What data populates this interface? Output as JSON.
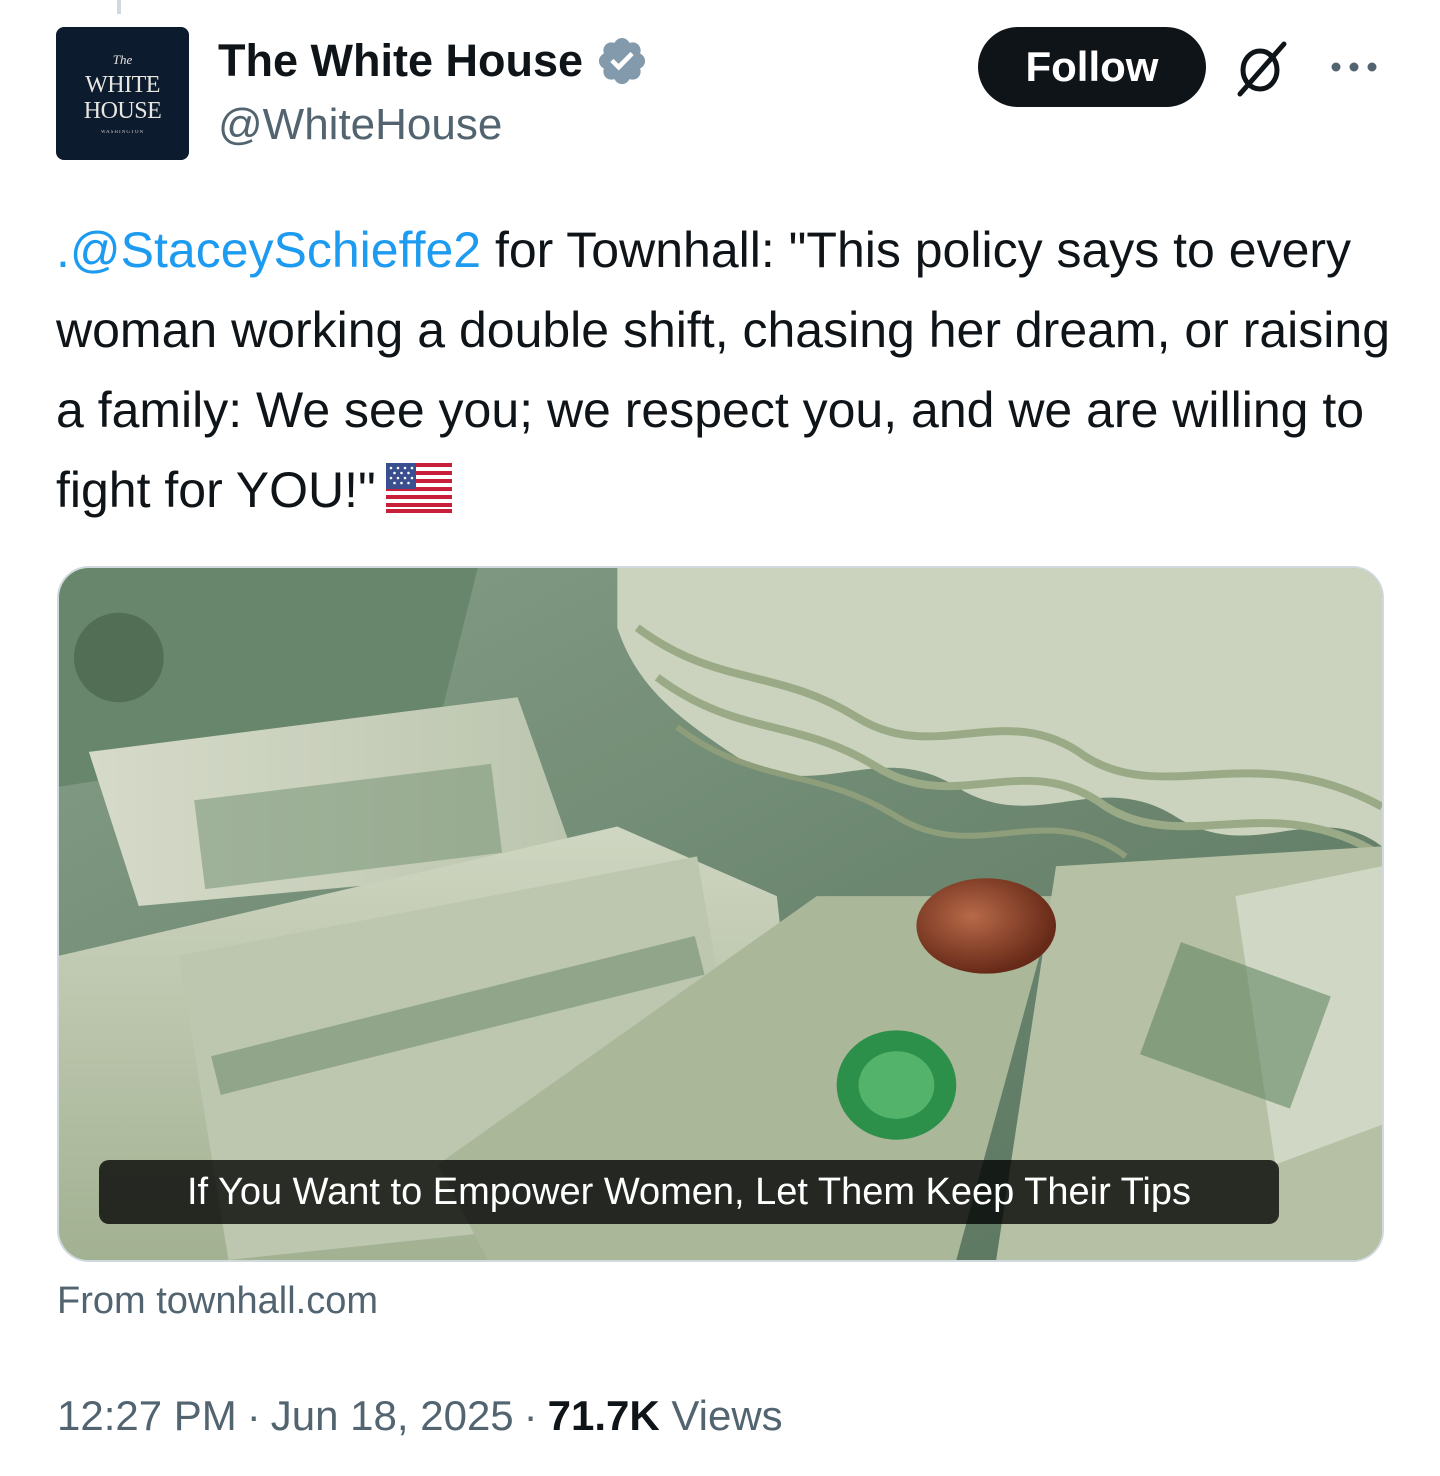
{
  "author": {
    "display_name": "The White House",
    "handle": "@WhiteHouse",
    "avatar": {
      "line1": "The",
      "line2": "WHITE",
      "line3": "HOUSE",
      "line4": "WASHINGTON"
    },
    "verified_icon": "verified-badge-icon",
    "verified_color": "#829aab"
  },
  "actions": {
    "follow_label": "Follow",
    "grok_icon": "grok-icon",
    "more_icon": "more-dots-icon"
  },
  "tweet": {
    "mention": ".@StaceySchieffe2",
    "body": " for Townhall: \"This policy says to every woman working a double shift, chasing her dream, or raising a family: We see you; we respect you, and we are willing to fight for YOU!\"",
    "emoji": "us-flag-emoji"
  },
  "card": {
    "headline": "If You Want to Empower Women, Let Them Keep Their Tips",
    "image_description_icon": "money-tips-photo",
    "source": "From townhall.com"
  },
  "meta": {
    "time": "12:27 PM",
    "date": "Jun 18, 2025",
    "separator": "·",
    "views_count": "71.7K",
    "views_label": "Views"
  },
  "colors": {
    "text_primary": "#0f1419",
    "text_secondary": "#536471",
    "link": "#1d9bf0",
    "border": "#cfd9de"
  }
}
